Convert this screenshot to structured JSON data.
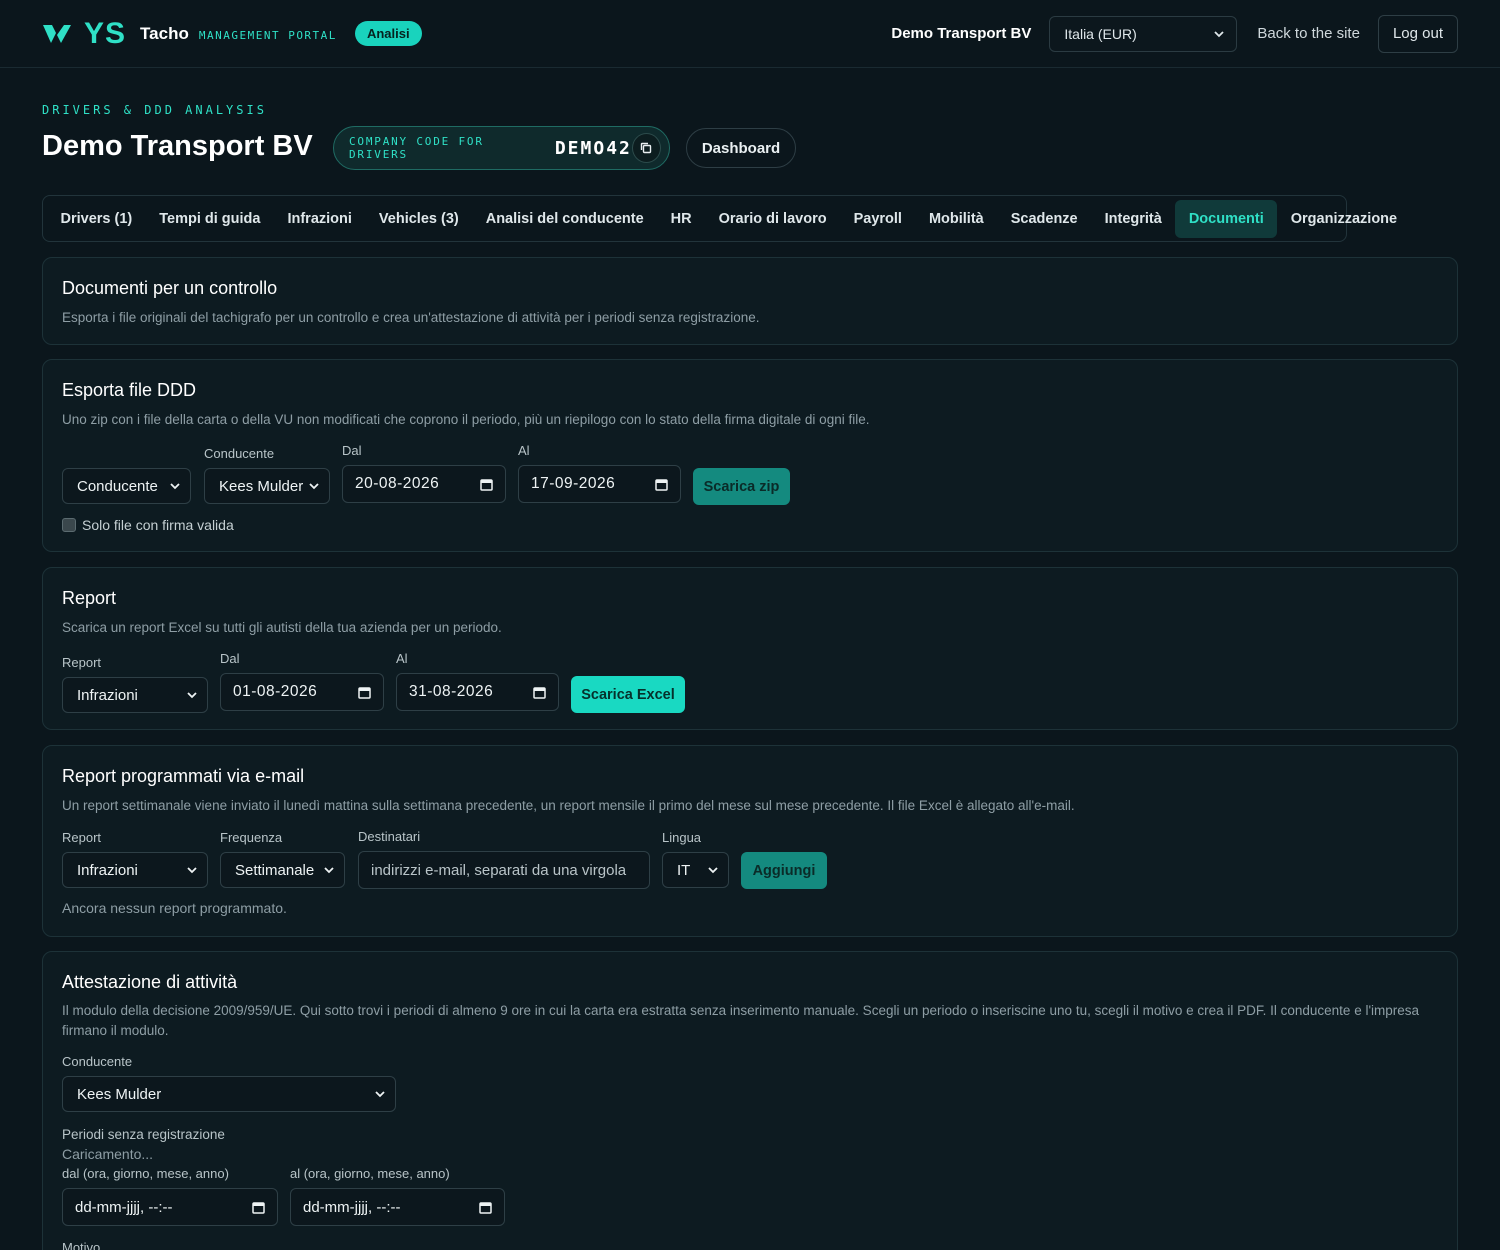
{
  "brand": {
    "logo_text": "YS",
    "product": "Tacho",
    "product_sub": "MANAGEMENT PORTAL",
    "badge": "Analisi",
    "accent": "#2fe0c6"
  },
  "topbar": {
    "company": "Demo Transport BV",
    "region_select": "Italia (EUR)",
    "back_link": "Back to the site",
    "logout": "Log out"
  },
  "header": {
    "eyebrow": "DRIVERS & DDD ANALYSIS",
    "title": "Demo Transport BV",
    "code_label": "COMPANY CODE FOR DRIVERS",
    "code_value": "DEMO42",
    "dashboard": "Dashboard"
  },
  "tabs": [
    {
      "label": "Drivers (1)",
      "active": false
    },
    {
      "label": "Tempi di guida",
      "active": false
    },
    {
      "label": "Infrazioni",
      "active": false
    },
    {
      "label": "Vehicles (3)",
      "active": false
    },
    {
      "label": "Analisi del conducente",
      "active": false
    },
    {
      "label": "HR",
      "active": false
    },
    {
      "label": "Orario di lavoro",
      "active": false
    },
    {
      "label": "Payroll",
      "active": false
    },
    {
      "label": "Mobilità",
      "active": false
    },
    {
      "label": "Scadenze",
      "active": false
    },
    {
      "label": "Integrità",
      "active": false
    },
    {
      "label": "Documenti",
      "active": true
    },
    {
      "label": "Organizzazione",
      "active": false
    }
  ],
  "docs": {
    "title": "Documenti per un controllo",
    "desc": "Esporta i file originali del tachigrafo per un controllo e crea un'attestazione di attività per i periodi senza registrazione."
  },
  "ddd": {
    "title": "Esporta file DDD",
    "desc": "Uno zip con i file della carta o della VU non modificati che coprono il periodo, più un riepilogo con lo stato della firma digitale di ogni file.",
    "type_select": "Conducente",
    "driver_label": "Conducente",
    "driver_select": "Kees Mulder",
    "from_label": "Dal",
    "from_value": "20-08-2026",
    "to_label": "Al",
    "to_value": "17-09-2026",
    "button": "Scarica zip",
    "checkbox_label": "Solo file con firma valida"
  },
  "report": {
    "title": "Report",
    "desc": "Scarica un report Excel su tutti gli autisti della tua azienda per un periodo.",
    "report_label": "Report",
    "report_select": "Infrazioni",
    "from_label": "Dal",
    "from_value": "01-08-2026",
    "to_label": "Al",
    "to_value": "31-08-2026",
    "button": "Scarica Excel"
  },
  "scheduled": {
    "title": "Report programmati via e-mail",
    "desc": "Un report settimanale viene inviato il lunedì mattina sulla settimana precedente, un report mensile il primo del mese sul mese precedente. Il file Excel è allegato all'e-mail.",
    "report_label": "Report",
    "report_select": "Infrazioni",
    "freq_label": "Frequenza",
    "freq_select": "Settimanale",
    "recipients_label": "Destinatari",
    "recipients_placeholder": "indirizzi e-mail, separati da una virgola",
    "lang_label": "Lingua",
    "lang_select": "IT",
    "button": "Aggiungi",
    "empty": "Ancora nessun report programmato."
  },
  "attest": {
    "title": "Attestazione di attività",
    "desc": "Il modulo della decisione 2009/959/UE. Qui sotto trovi i periodi di almeno 9 ore in cui la carta era estratta senza inserimento manuale. Scegli un periodo o inseriscine uno tu, scegli il motivo e crea il PDF. Il conducente e l'impresa firmano il modulo.",
    "driver_label": "Conducente",
    "driver_select": "Kees Mulder",
    "periods_label": "Periodi senza registrazione",
    "loading": "Caricamento...",
    "from_label": "dal (ora, giorno, mese, anno)",
    "from_placeholder": "dd-mm-jjjj, --:--",
    "to_label": "al (ora, giorno, mese, anno)",
    "to_placeholder": "dd-mm-jjjj, --:--",
    "reason_label": "Motivo"
  }
}
